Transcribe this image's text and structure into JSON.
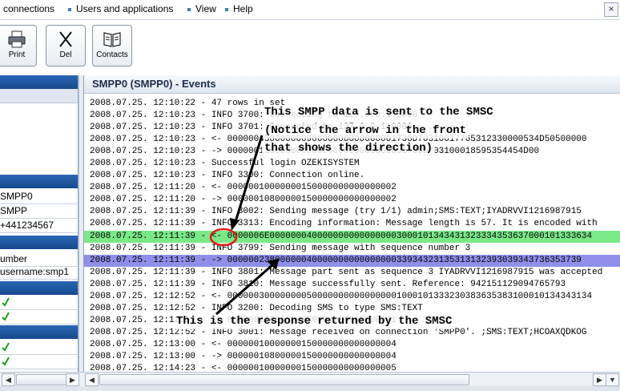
{
  "menu": {
    "items": [
      "connections",
      "Users and applications",
      "View",
      "Help"
    ],
    "close_glyph": "×"
  },
  "toolbar": {
    "print_label": "Print",
    "del_label": "Del",
    "contacts_label": "Contacts"
  },
  "left_panel": {
    "rows": [
      "SMPP0",
      "SMPP",
      "+441234567"
    ],
    "rows2": [
      "umber",
      "username:smp1"
    ]
  },
  "events": {
    "title": "SMPP0 (SMPP0) - Events",
    "lines": [
      "2008.07.25. 12:10:22 - 47 rows in set",
      "2008.07.25. 12:10:23 - INFO 3700: Connecting to 127.0.0.1:9000",
      "2008.07.25. 12:10:23 - INFO 3701: Connected to 127.0.0.1:9000 ...",
      "2008.07.25. 12:10:23 - <- 00000045000000090000000000000001736D70310017765312330000534D50500000",
      "2008.07.25. 12:10:23 - -> 0000001380000009000000000000000001736D703100018595354454D00",
      "2008.07.25. 12:10:23 - Successful login OZEKISYSTEM",
      "2008.07.25. 12:10:23 - INFO 3300: Connection online.",
      "2008.07.25. 12:11:20 - <- 00000010000000150000000000000002",
      "2008.07.25. 12:11:20 - -> 00000010800000150000000000000002",
      "2008.07.25. 12:11:39 - INFO 3002: Sending message (try 1/1) admin;SMS:TEXT;IYADRVVI1216987915",
      "2008.07.25. 12:11:39 - INFO 3313: Encoding information: Message length is 57. It is encoded with",
      "2008.07.25. 12:11:39 - <- 0000006E0000000400000000000000003000101343431323334353637000101333634",
      "2008.07.25. 12:11:39 - INFO 3799: Sending message with sequence number 3",
      "2008.07.25. 12:11:39 - -> 0000002380000004000000000000000033934323135313132393039343736353739",
      "2008.07.25. 12:11:39 - INFO 3801: Message part sent as sequence 3 IYADRVVI1216987915 was accepted",
      "2008.07.25. 12:11:39 - INFO 3810: Message successfully sent. Reference: 942151129094765793",
      "2008.07.25. 12:12:52 - <- 000000300000000500000000000000001000101333230383635383100010134343134",
      "2008.07.25. 12:12:52 - INFO 3200: Decoding SMS to type SMS:TEXT",
      "2008.07.25. 12:12:52 - -> 00000011800000050000000000000001",
      "2008.07.25. 12:12:52 - INFO 3001: Message received on connection 'SMPP0'. ;SMS:TEXT;HCOAXQDKOG",
      "2008.07.25. 12:13:00 - <- 00000010000000150000000000000004",
      "2008.07.25. 12:13:00 - -> 00000010800000150000000000000004",
      "2008.07.25. 12:14:23 - <- 00000010000000150000000000000005"
    ],
    "annotation_top": [
      "This SMPP data is sent to the SMSC",
      "(Notice the arrow in the front",
      "that shows the direction)"
    ],
    "annotation_bottom": "This is the response returned by the SMSC"
  },
  "scroll": {
    "left_glyph": "◀",
    "right_glyph": "▶",
    "down_glyph": "▼"
  },
  "colors": {
    "sent_highlight": "#7be887",
    "response_highlight": "#8f8fea",
    "annotation_circle": "#e01818"
  }
}
